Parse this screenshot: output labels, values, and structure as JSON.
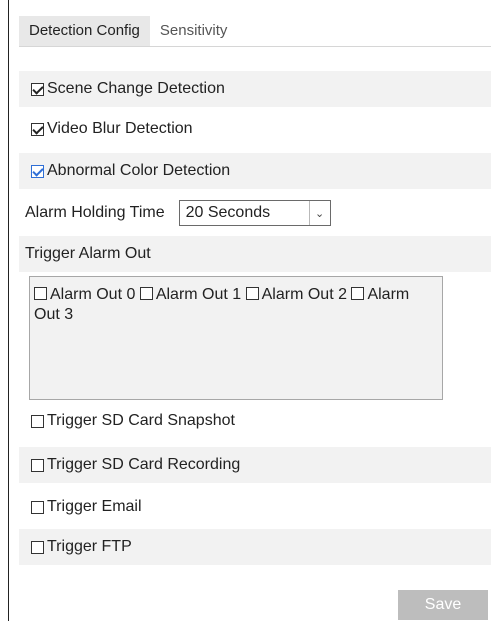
{
  "tabs": [
    {
      "label": "Detection Config",
      "active": true
    },
    {
      "label": "Sensitivity",
      "active": false
    }
  ],
  "detection": {
    "scene_change": {
      "label": "Scene Change Detection",
      "checked": true
    },
    "video_blur": {
      "label": "Video Blur Detection",
      "checked": true
    },
    "abnormal_color": {
      "label": "Abnormal Color Detection",
      "checked": true
    }
  },
  "alarm_holding": {
    "label": "Alarm Holding Time",
    "value": "20 Seconds"
  },
  "trigger_alarm_out": {
    "label": "Trigger Alarm Out",
    "items": [
      {
        "label": "Alarm Out 0",
        "checked": false
      },
      {
        "label": "Alarm Out 1",
        "checked": false
      },
      {
        "label": "Alarm Out 2",
        "checked": false
      },
      {
        "label": "Alarm Out 3",
        "checked": false
      }
    ]
  },
  "triggers": [
    {
      "label": "Trigger SD Card Snapshot",
      "checked": false
    },
    {
      "label": "Trigger SD Card Recording",
      "checked": false
    },
    {
      "label": "Trigger Email",
      "checked": false
    },
    {
      "label": "Trigger FTP",
      "checked": false
    }
  ],
  "save_label": "Save",
  "colors": {
    "check_accent": "#2f6fd6",
    "save_bg": "#bdbdbd"
  }
}
